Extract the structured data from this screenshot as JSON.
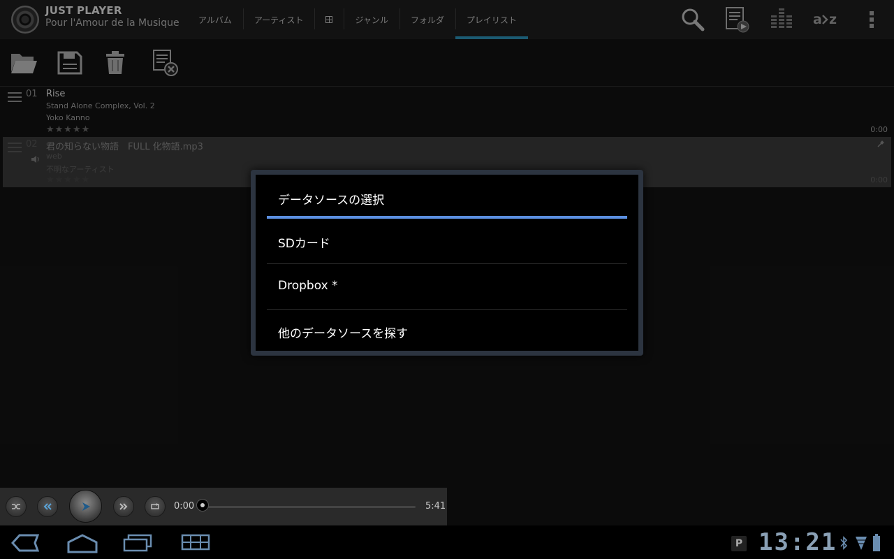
{
  "app": {
    "title": "JUST PLAYER",
    "subtitle": "Pour l'Amour de la Musique"
  },
  "tabs": [
    {
      "label": "アルバム"
    },
    {
      "label": "アーティスト"
    },
    {
      "label": "",
      "icon": "grid-icon"
    },
    {
      "label": "ジャンル"
    },
    {
      "label": "フォルダ"
    },
    {
      "label": "プレイリスト",
      "active": true
    }
  ],
  "top_actions": [
    "search-icon",
    "now-playing-list-icon",
    "equalizer-icon",
    "sort-az-icon",
    "overflow-menu-icon"
  ],
  "toolbar": [
    "open-folder-icon",
    "save-icon",
    "trash-icon",
    "clear-playlist-icon"
  ],
  "tracks": [
    {
      "num": "01",
      "title": "Rise",
      "album": "Stand Alone Complex, Vol. 2",
      "artist": "Yoko Kanno",
      "stars": "★★★★★",
      "duration": "0:00",
      "selected": false
    },
    {
      "num": "02",
      "title": "君の知らない物語　FULL 化物語.mp3",
      "album": "web",
      "artist": "不明なアーティスト",
      "stars": "★★★★★",
      "duration": "0:00",
      "selected": true
    }
  ],
  "dialog": {
    "title": "データソースの選択",
    "items": [
      {
        "label": "SDカード"
      },
      {
        "label": "Dropbox *"
      },
      {
        "label": "他のデータソースを探す"
      }
    ]
  },
  "player": {
    "elapsed": "0:00",
    "total": "5:41",
    "progress": 0
  },
  "system": {
    "clock": "13:21",
    "notification": "P"
  },
  "colors": {
    "accent": "#2a8ab0",
    "dialog_rule": "#5b8fe0"
  }
}
